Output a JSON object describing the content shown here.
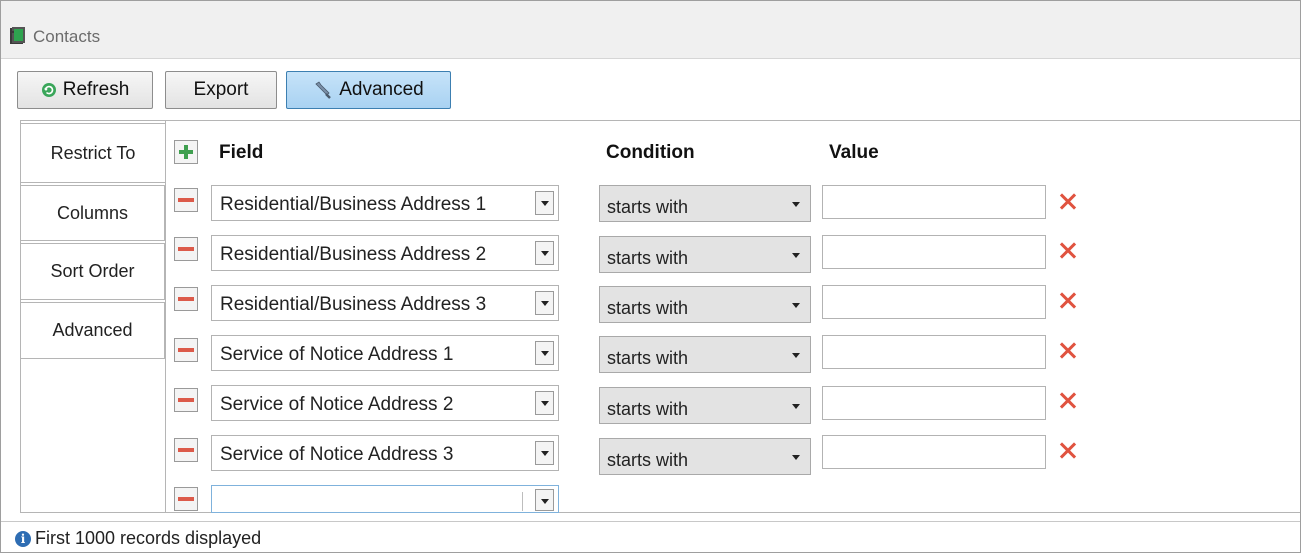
{
  "window": {
    "title": "Contacts"
  },
  "toolbar": {
    "refresh_label": "Refresh",
    "export_label": "Export",
    "advanced_label": "Advanced"
  },
  "tabs": [
    {
      "label": "Restrict To",
      "selected": true
    },
    {
      "label": "Columns",
      "selected": false
    },
    {
      "label": "Sort Order",
      "selected": false
    },
    {
      "label": "Advanced",
      "selected": false
    }
  ],
  "grid": {
    "headers": {
      "field": "Field",
      "condition": "Condition",
      "value": "Value"
    },
    "rows": [
      {
        "field": "Residential/Business Address 1",
        "condition": "starts with",
        "value": ""
      },
      {
        "field": "Residential/Business Address 2",
        "condition": "starts with",
        "value": ""
      },
      {
        "field": "Residential/Business Address 3",
        "condition": "starts with",
        "value": ""
      },
      {
        "field": "Service of Notice Address 1",
        "condition": "starts with",
        "value": ""
      },
      {
        "field": "Service of Notice Address 2",
        "condition": "starts with",
        "value": ""
      },
      {
        "field": "Service of Notice Address 3",
        "condition": "starts with",
        "value": ""
      }
    ],
    "new_row": {
      "field": ""
    }
  },
  "status": {
    "text": "First 1000 records displayed",
    "icon": "info-icon"
  },
  "colors": {
    "accent": "#a9d2f2",
    "add": "#3f9f4f",
    "remove": "#dc5a4a",
    "delete": "#e0533f"
  }
}
